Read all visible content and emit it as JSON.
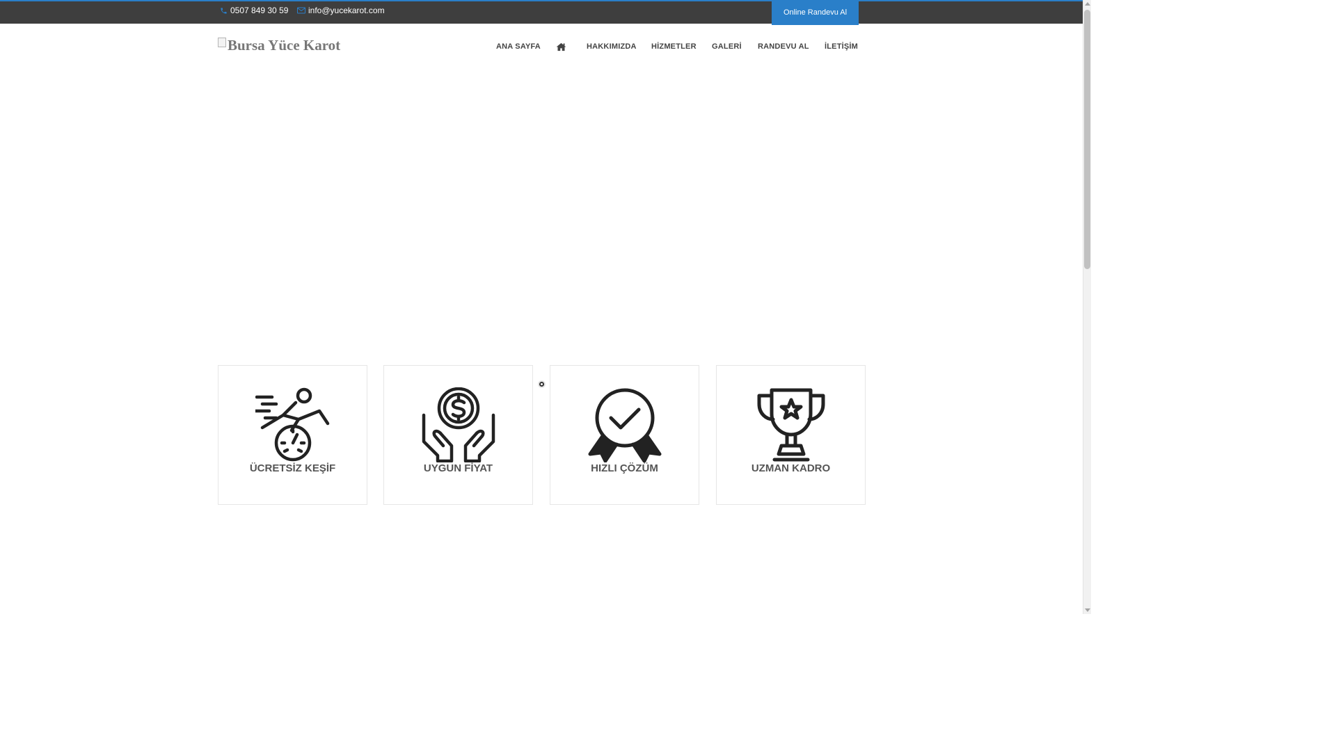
{
  "topbar": {
    "phone": "0507 849 30 59",
    "email": "info@yucekarot.com",
    "cta_label": "Online Randevu Al",
    "phone_icon": "phone-icon",
    "email_icon": "envelope-icon"
  },
  "header": {
    "logo_alt": "Bursa Yüce Karot",
    "nav": [
      {
        "label": "ANA SAYFA"
      },
      {
        "label": "",
        "icon": "home-icon"
      },
      {
        "label": "HAKKIMIZDA"
      },
      {
        "label": "HİZMETLER"
      },
      {
        "label": "GALERİ"
      },
      {
        "label": "RANDEVU AL"
      },
      {
        "label": "İLETİŞİM"
      }
    ]
  },
  "features": [
    {
      "title": "ÜCRETSİZ KEŞİF",
      "icon": "running-speedometer-icon"
    },
    {
      "title": "UYGUN FİYAT",
      "icon": "hands-coin-icon"
    },
    {
      "title": "HIZLI ÇÖZÜM",
      "icon": "badge-check-icon"
    },
    {
      "title": "UZMAN KADRO",
      "icon": "trophy-star-icon"
    }
  ],
  "colors": {
    "accent": "#2a7fc9",
    "topbar_bg": "#3e3e3e",
    "text_dark": "#444444",
    "card_title": "#555555",
    "card_border": "#e6e6e6"
  }
}
